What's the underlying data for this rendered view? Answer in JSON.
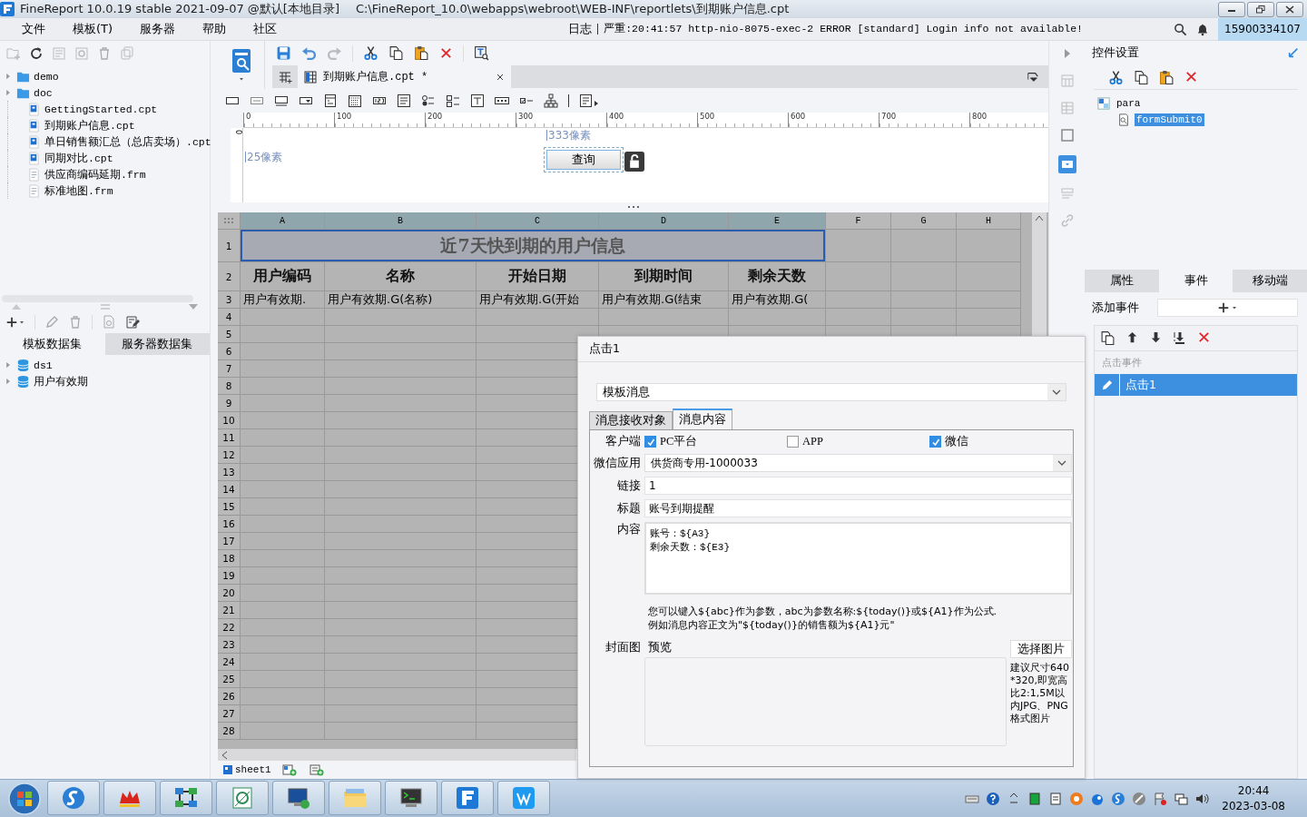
{
  "window": {
    "title": "FineReport 10.0.19 stable 2021-09-07 @默认[本地目录]",
    "path": "C:\\FineReport_10.0\\webapps\\webroot\\WEB-INF\\reportlets\\到期账户信息.cpt"
  },
  "menu": [
    {
      "label": "文件"
    },
    {
      "label": "模板(T)"
    },
    {
      "label": "服务器"
    },
    {
      "label": "帮助"
    },
    {
      "label": "社区"
    }
  ],
  "log": {
    "label": "日志",
    "message": "严重:20:41:57 http-nio-8075-exec-2 ERROR [standard] Login info not available!"
  },
  "user": "15900334107",
  "left_panel": {
    "tree": [
      {
        "label": "demo",
        "kind": "folder",
        "expanded": false
      },
      {
        "label": "doc",
        "kind": "folder",
        "expanded": false
      },
      {
        "label": "GettingStarted.cpt",
        "kind": "cpt"
      },
      {
        "label": "到期账户信息.cpt",
        "kind": "cpt"
      },
      {
        "label": "单日销售额汇总（总店卖场）.cpt",
        "kind": "cpt"
      },
      {
        "label": "同期对比.cpt",
        "kind": "cpt"
      },
      {
        "label": "供应商编码延期.frm",
        "kind": "frm"
      },
      {
        "label": "标准地图.frm",
        "kind": "frm"
      }
    ],
    "dataset_tabs": [
      {
        "label": "模板数据集",
        "selected": true
      },
      {
        "label": "服务器数据集",
        "selected": false
      }
    ],
    "datasets": [
      {
        "label": "ds1",
        "expanded": false
      },
      {
        "label": "用户有效期",
        "expanded": false
      }
    ]
  },
  "editor": {
    "tab": "到期账户信息.cpt *",
    "ruler": [
      "0",
      "100",
      "200",
      "300",
      "400",
      "500",
      "600",
      "700",
      "800"
    ],
    "ruler_v": "0",
    "param_canvas": {
      "x_label": "333像素",
      "y_label": "25像素",
      "button": "查询"
    },
    "columns": [
      {
        "label": "A",
        "selected": true
      },
      {
        "label": "B",
        "selected": true
      },
      {
        "label": "C",
        "selected": true
      },
      {
        "label": "D",
        "selected": true
      },
      {
        "label": "E",
        "selected": true
      },
      {
        "label": "F",
        "selected": false
      },
      {
        "label": "G",
        "selected": false
      },
      {
        "label": "H",
        "selected": false
      }
    ],
    "rows": [
      {
        "number": "1",
        "kind": "title",
        "cells": [
          "近7天快到期的用户信息"
        ],
        "selected": true
      },
      {
        "number": "2",
        "kind": "header",
        "cells": [
          "用户编码",
          "名称",
          "开始日期",
          "到期时间",
          "剩余天数"
        ]
      },
      {
        "number": "3",
        "kind": "data",
        "cells": [
          "用户有效期.",
          "用户有效期.G(名称)",
          "用户有效期.G(开始",
          "用户有效期.G(结束",
          "用户有效期.G("
        ]
      },
      {
        "number": "4",
        "kind": "empty"
      },
      {
        "number": "5",
        "kind": "empty"
      },
      {
        "number": "6",
        "kind": "empty"
      },
      {
        "number": "7",
        "kind": "empty"
      },
      {
        "number": "8",
        "kind": "empty"
      },
      {
        "number": "9",
        "kind": "empty"
      },
      {
        "number": "10",
        "kind": "empty"
      },
      {
        "number": "11",
        "kind": "empty"
      },
      {
        "number": "12",
        "kind": "empty"
      },
      {
        "number": "13",
        "kind": "empty"
      },
      {
        "number": "14",
        "kind": "empty"
      },
      {
        "number": "15",
        "kind": "empty"
      },
      {
        "number": "16",
        "kind": "empty"
      },
      {
        "number": "17",
        "kind": "empty"
      },
      {
        "number": "18",
        "kind": "empty"
      },
      {
        "number": "19",
        "kind": "empty"
      },
      {
        "number": "20",
        "kind": "empty"
      },
      {
        "number": "21",
        "kind": "empty"
      },
      {
        "number": "22",
        "kind": "empty"
      },
      {
        "number": "23",
        "kind": "empty"
      },
      {
        "number": "24",
        "kind": "empty"
      },
      {
        "number": "25",
        "kind": "empty"
      },
      {
        "number": "26",
        "kind": "empty"
      },
      {
        "number": "27",
        "kind": "empty"
      },
      {
        "number": "28",
        "kind": "empty"
      }
    ],
    "sheet_tab": "sheet1"
  },
  "dialog": {
    "title": "点击1",
    "type_select": "模板消息",
    "tabs": [
      {
        "label": "消息接收对象",
        "selected": false
      },
      {
        "label": "消息内容",
        "selected": true
      }
    ],
    "client_label": "客户端",
    "clients": [
      {
        "label": "PC平台",
        "checked": true
      },
      {
        "label": "APP",
        "checked": false
      },
      {
        "label": "微信",
        "checked": true
      }
    ],
    "fields": [
      {
        "label": "微信应用",
        "kind": "select",
        "value": "供货商专用-1000033"
      },
      {
        "label": "链接",
        "kind": "input",
        "value": "1"
      },
      {
        "label": "标题",
        "kind": "input",
        "value": "账号到期提醒"
      },
      {
        "label": "内容",
        "kind": "textarea",
        "value": "账号：${A3}\n剩余天数：${E3}"
      }
    ],
    "hint": [
      "您可以键入${abc}作为参数，abc为参数名称:${today()}或${A1}作为公式.",
      "例如消息内容正文为\"${today()}的销售额为${A1}元\""
    ],
    "cover": {
      "label": "封面图",
      "preview": "预览",
      "button": "选择图片",
      "note": "建议尺寸640*320,即宽高比2:1,5M以内JPG、PNG格式图片"
    }
  },
  "right_panel": {
    "title": "控件设置",
    "tree": [
      {
        "label": "para",
        "kind": "panel",
        "selected": false,
        "children": [
          {
            "label": "formSubmit0",
            "kind": "widget",
            "selected": true
          }
        ]
      }
    ],
    "tabs": [
      {
        "label": "属性",
        "selected": false
      },
      {
        "label": "事件",
        "selected": true
      },
      {
        "label": "移动端",
        "selected": false
      }
    ],
    "add_event_label": "添加事件",
    "event_group": "点击事件",
    "events": [
      {
        "label": "点击1",
        "selected": true
      }
    ]
  },
  "clock": {
    "time": "20:44",
    "date": "2023-03-08"
  }
}
